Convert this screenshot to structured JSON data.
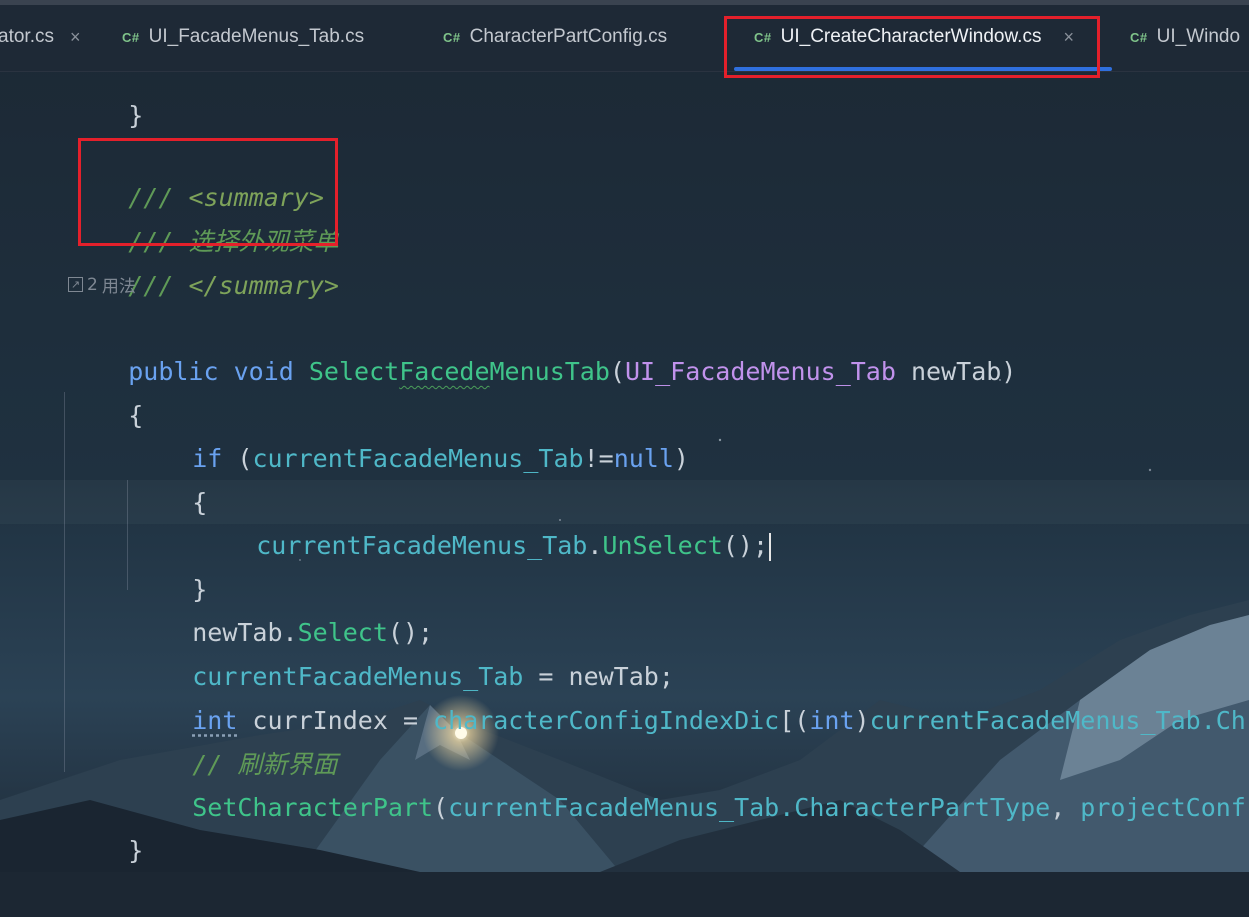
{
  "tabs": [
    {
      "label": "ator.cs",
      "badge": "",
      "active": false,
      "closable": true
    },
    {
      "label": "UI_FacadeMenus_Tab.cs",
      "badge": "C#",
      "active": false,
      "closable": false
    },
    {
      "label": "CharacterPartConfig.cs",
      "badge": "C#",
      "active": false,
      "closable": false
    },
    {
      "label": "UI_CreateCharacterWindow.cs",
      "badge": "C#",
      "active": true,
      "closable": true
    },
    {
      "label": "UI_Windo",
      "badge": "C#",
      "active": false,
      "closable": false
    }
  ],
  "close_glyph": "×",
  "usages": {
    "count": "2",
    "label": "用法"
  },
  "code": {
    "brace_close_top": "}",
    "summary_open_prefix": "/// ",
    "summary_open_tag": "<summary>",
    "summary_text_prefix": "/// ",
    "summary_text": "选择外观菜单",
    "summary_close_prefix": "/// ",
    "summary_close_tag": "</summary>",
    "sig_public": "public",
    "sig_void": "void",
    "sig_name_a": "Select",
    "sig_name_b": "Facede",
    "sig_name_c": "MenusTab",
    "sig_paren_open": "(",
    "sig_param_type": "UI_FacadeMenus_Tab",
    "sig_param_name": "newTab",
    "sig_paren_close": ")",
    "brace_open": "{",
    "if_kw": "if",
    "if_open": " (",
    "if_var": "currentFacadeMenus_Tab",
    "if_op": "!=",
    "if_null": "null",
    "if_close": ")",
    "inner_brace_open": "{",
    "unselect_obj": "currentFacadeMenus_Tab",
    "unselect_dot": ".",
    "unselect_fn": "UnSelect",
    "unselect_end": "();",
    "inner_brace_close": "}",
    "select_obj": "newTab",
    "select_dot": ".",
    "select_fn": "Select",
    "select_end": "();",
    "assign_var": "currentFacadeMenus_Tab",
    "assign_rest": " = newTab;",
    "int_kw": "int",
    "curr_index": " currIndex = ",
    "dic_name": "characterConfigIndexDic",
    "dic_open": "[(",
    "dic_cast": "int",
    "dic_close": ")",
    "dic_var": "currentFacadeMenus_Tab",
    "dic_tail": ".Ch",
    "comment_prefix": "// ",
    "comment_text": "刷新界面",
    "setpart_fn": "SetCharacterPart",
    "setpart_open": "(",
    "setpart_var": "currentFacadeMenus_Tab",
    "setpart_prop": ".CharacterPartType",
    "setpart_comma": ", ",
    "setpart_tail": "projectConf",
    "brace_close": "}"
  },
  "colors": {
    "accent_underline": "#2f6fde",
    "highlight_box": "#e4202b",
    "keyword": "#6aa2f0",
    "method": "#3fc48a",
    "type": "#c192ec",
    "identifier": "#4fb8c8",
    "doc_comment": "#5f9a57"
  }
}
